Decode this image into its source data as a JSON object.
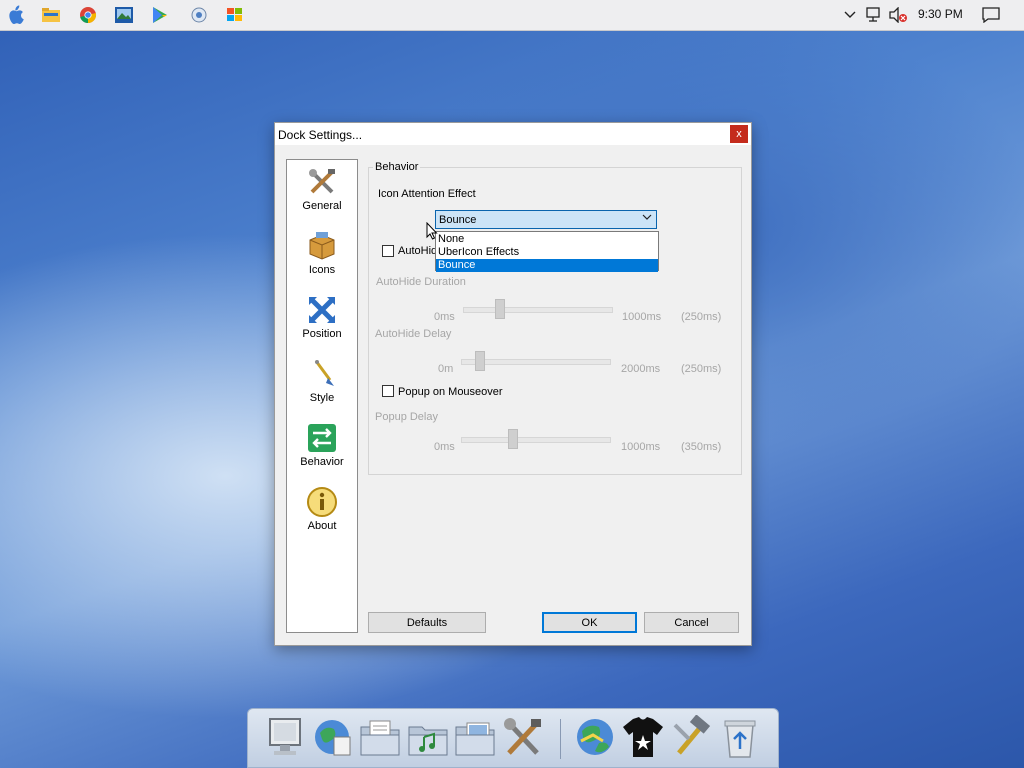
{
  "taskbar": {
    "icons": [
      "apple-icon",
      "file-explorer-icon",
      "chrome-icon",
      "photo-viewer-icon",
      "play-store-icon",
      "maintenance-icon",
      "windows-icon"
    ],
    "tray_icons": [
      "chevron-up-icon",
      "network-icon",
      "speaker-muted-icon"
    ],
    "clock": "9:30 PM",
    "notification_icon": "notification-icon"
  },
  "dialog": {
    "title": "Dock Settings...",
    "close_label": "x",
    "nav": [
      {
        "label": "General",
        "icon": "tools-icon"
      },
      {
        "label": "Icons",
        "icon": "box-icon"
      },
      {
        "label": "Position",
        "icon": "arrows-icon"
      },
      {
        "label": "Style",
        "icon": "brush-icon"
      },
      {
        "label": "Behavior",
        "icon": "switch-arrows-icon"
      },
      {
        "label": "About",
        "icon": "info-icon"
      }
    ],
    "group_title": "Behavior",
    "attention_label": "Icon Attention Effect",
    "attention_value": "Bounce",
    "attention_options": [
      "None",
      "UberIcon Effects",
      "Bounce"
    ],
    "autohide_label": "AutoHid",
    "autohide_duration": {
      "label": "AutoHide Duration",
      "min": "0ms",
      "max": "1000ms",
      "current": "(250ms)",
      "level": 0.25
    },
    "autohide_delay": {
      "label": "AutoHide Delay",
      "min": "0m",
      "max": "2000ms",
      "current": "(250ms)",
      "level": 0.125
    },
    "popup_label": "Popup on Mouseover",
    "popup_delay": {
      "label": "Popup Delay",
      "min": "0ms",
      "max": "1000ms",
      "current": "(350ms)",
      "level": 0.35
    },
    "buttons": {
      "defaults": "Defaults",
      "ok": "OK",
      "cancel": "Cancel"
    }
  },
  "dock": {
    "items": [
      "monitor-icon",
      "globe-icon",
      "folder-documents-icon",
      "folder-music-icon",
      "folder-pictures-icon",
      "tools-icon",
      "globe-icon",
      "tshirt-icon",
      "hammer-icon",
      "recycle-bin-icon"
    ]
  },
  "colors": {
    "accent": "#0078d7",
    "close": "#c42b1c"
  }
}
